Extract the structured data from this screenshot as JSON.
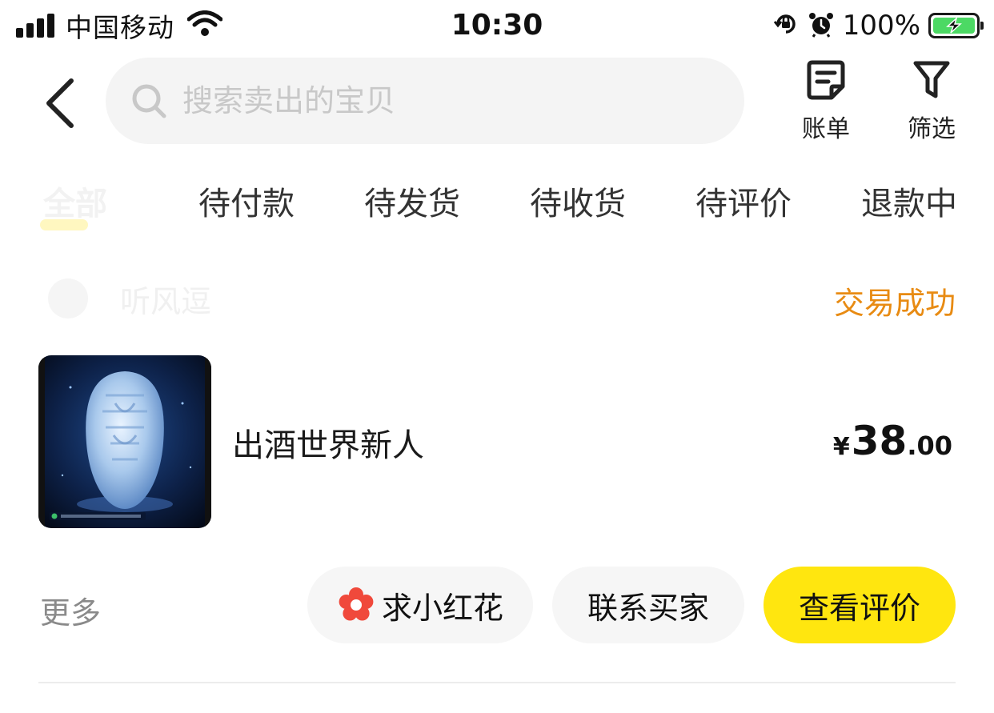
{
  "status_bar": {
    "carrier": "中国移动",
    "time": "10:30",
    "battery_percent": "100%",
    "battery_level": 1.0,
    "signal_bars": 4,
    "icons": [
      "signal-icon",
      "wifi-icon",
      "rotation-lock-icon",
      "alarm-icon",
      "battery-charging-icon"
    ]
  },
  "header": {
    "search_placeholder": "搜索卖出的宝贝",
    "actions": [
      {
        "label": "账单",
        "icon": "bill-icon"
      },
      {
        "label": "筛选",
        "icon": "filter-icon"
      }
    ]
  },
  "tabs": [
    {
      "label": "全部",
      "active": true
    },
    {
      "label": "待付款"
    },
    {
      "label": "待发货"
    },
    {
      "label": "待收货"
    },
    {
      "label": "待评价"
    },
    {
      "label": "退款中"
    }
  ],
  "order": {
    "shop_name": "听风逗",
    "status": "交易成功",
    "product": {
      "title": "出酒世界新人",
      "price_symbol": "¥",
      "price_integer": "38",
      "price_decimal": ".00"
    },
    "more_label": "更多",
    "buttons": {
      "flower": "求小红花",
      "contact": "联系买家",
      "review": "查看评价"
    }
  },
  "colors": {
    "accent_yellow": "#ffe60f",
    "status_orange": "#e88b13",
    "battery_green": "#4cd964",
    "flower_red": "#f0493b",
    "search_bg": "#f4f4f4"
  }
}
